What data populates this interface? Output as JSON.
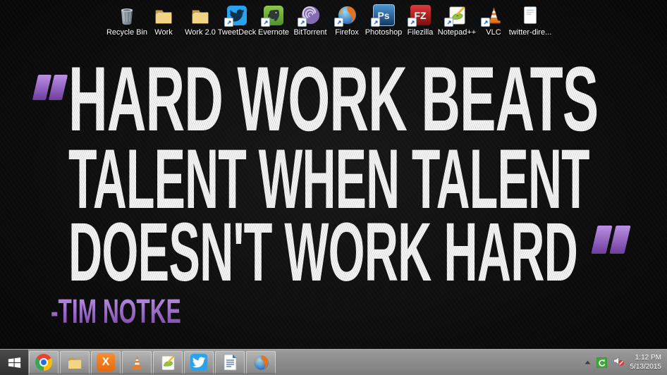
{
  "wallpaper": {
    "quote": {
      "open_mark": "“",
      "line1": "HARD WORK BEATS",
      "line2": "TALENT WHEN TALENT",
      "line3": "DOESN'T WORK HARD",
      "close_mark": "”",
      "attribution": "-TIM NOTKE"
    },
    "colors": {
      "background": "#0c0c0c",
      "quote_text": "#ededed",
      "accent_purple": "#9a5ecb"
    }
  },
  "desktop_icons": [
    {
      "label": "Recycle Bin",
      "icon": "recycle-bin-icon",
      "shortcut": false
    },
    {
      "label": "Work",
      "icon": "folder-icon",
      "shortcut": false
    },
    {
      "label": "Work 2.0",
      "icon": "folder-icon",
      "shortcut": false
    },
    {
      "label": "TweetDeck",
      "icon": "tweetdeck-icon",
      "shortcut": true
    },
    {
      "label": "Evernote",
      "icon": "evernote-icon",
      "shortcut": true
    },
    {
      "label": "BitTorrent",
      "icon": "bittorrent-icon",
      "shortcut": true
    },
    {
      "label": "Firefox",
      "icon": "firefox-icon",
      "shortcut": true
    },
    {
      "label": "Photoshop",
      "icon": "photoshop-icon",
      "shortcut": true
    },
    {
      "label": "Filezilla",
      "icon": "filezilla-icon",
      "shortcut": true
    },
    {
      "label": "Notepad++",
      "icon": "notepad-plus-plus-icon",
      "shortcut": true
    },
    {
      "label": "VLC",
      "icon": "vlc-icon",
      "shortcut": true
    },
    {
      "label": "twitter-dire...",
      "icon": "text-file-icon",
      "shortcut": false
    }
  ],
  "icon_glyphs": {
    "photoshop": "Ps",
    "filezilla": "FZ",
    "xampp": "X"
  },
  "taskbar": {
    "pinned_apps": [
      "google-chrome",
      "file-explorer",
      "xampp",
      "vlc",
      "notepad-plus-plus",
      "twitter",
      "libreoffice-writer",
      "firefox"
    ],
    "tray": {
      "icons": [
        "show-hidden-icons",
        "green-sync",
        "volume-muted"
      ],
      "time": "1:12 PM",
      "date": "5/13/2015"
    }
  }
}
